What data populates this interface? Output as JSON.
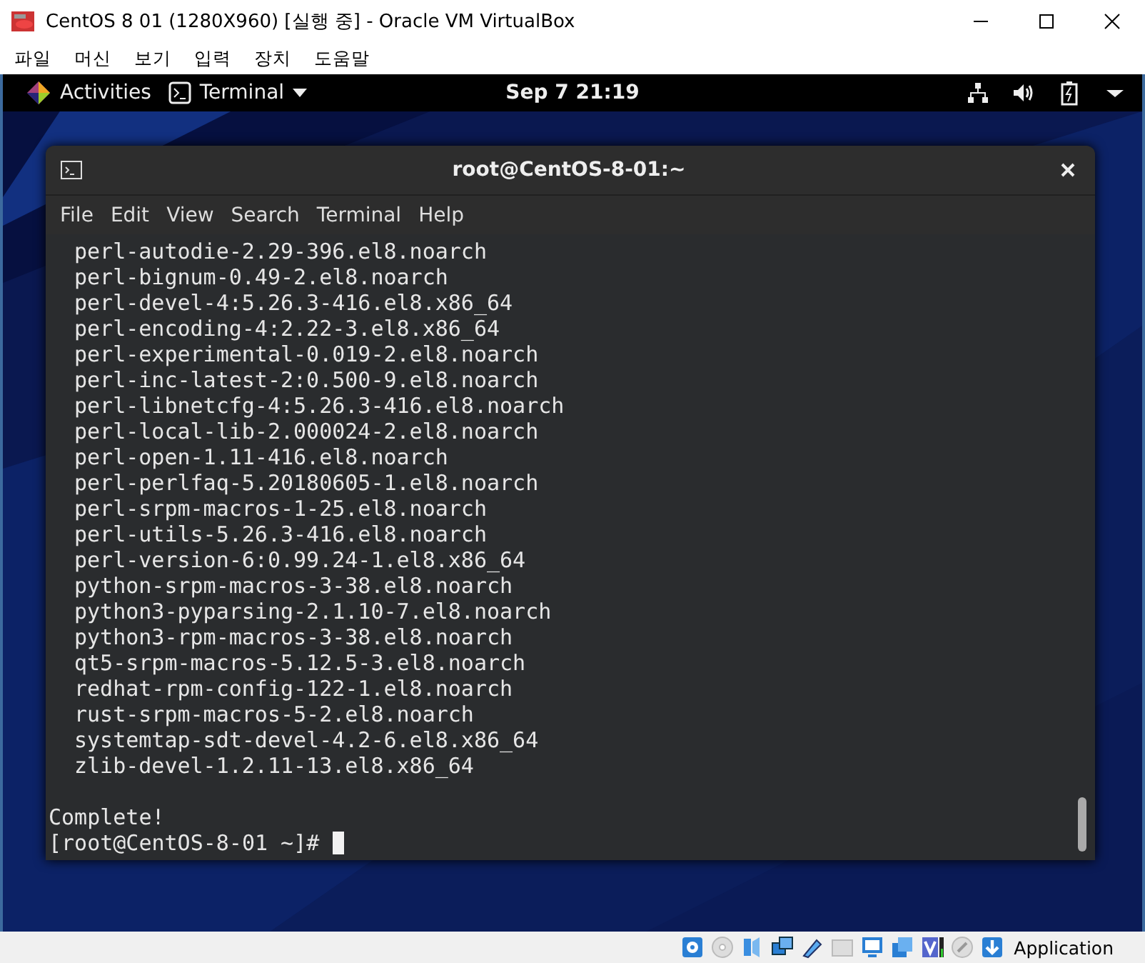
{
  "window": {
    "title": "CentOS 8 01 (1280X960) [실행 중] - Oracle VM VirtualBox"
  },
  "menu": [
    "파일",
    "머신",
    "보기",
    "입력",
    "장치",
    "도움말"
  ],
  "top_bar": {
    "activities": "Activities",
    "app": "Terminal",
    "clock": "Sep 7  21:19"
  },
  "terminal": {
    "title": "root@CentOS-8-01:~",
    "menu": [
      "File",
      "Edit",
      "View",
      "Search",
      "Terminal",
      "Help"
    ],
    "lines": [
      {
        "kind": "package",
        "text": "perl-autodie-2.29-396.el8.noarch"
      },
      {
        "kind": "package",
        "text": "perl-bignum-0.49-2.el8.noarch"
      },
      {
        "kind": "package",
        "text": "perl-devel-4:5.26.3-416.el8.x86_64"
      },
      {
        "kind": "package",
        "text": "perl-encoding-4:2.22-3.el8.x86_64"
      },
      {
        "kind": "package",
        "text": "perl-experimental-0.019-2.el8.noarch"
      },
      {
        "kind": "package",
        "text": "perl-inc-latest-2:0.500-9.el8.noarch"
      },
      {
        "kind": "package",
        "text": "perl-libnetcfg-4:5.26.3-416.el8.noarch"
      },
      {
        "kind": "package",
        "text": "perl-local-lib-2.000024-2.el8.noarch"
      },
      {
        "kind": "package",
        "text": "perl-open-1.11-416.el8.noarch"
      },
      {
        "kind": "package",
        "text": "perl-perlfaq-5.20180605-1.el8.noarch"
      },
      {
        "kind": "package",
        "text": "perl-srpm-macros-1-25.el8.noarch"
      },
      {
        "kind": "package",
        "text": "perl-utils-5.26.3-416.el8.noarch"
      },
      {
        "kind": "package",
        "text": "perl-version-6:0.99.24-1.el8.x86_64"
      },
      {
        "kind": "package",
        "text": "python-srpm-macros-3-38.el8.noarch"
      },
      {
        "kind": "package",
        "text": "python3-pyparsing-2.1.10-7.el8.noarch"
      },
      {
        "kind": "package",
        "text": "python3-rpm-macros-3-38.el8.noarch"
      },
      {
        "kind": "package",
        "text": "qt5-srpm-macros-5.12.5-3.el8.noarch"
      },
      {
        "kind": "package",
        "text": "redhat-rpm-config-122-1.el8.noarch"
      },
      {
        "kind": "package",
        "text": "rust-srpm-macros-5-2.el8.noarch"
      },
      {
        "kind": "package",
        "text": "systemtap-sdt-devel-4.2-6.el8.x86_64"
      },
      {
        "kind": "package",
        "text": "zlib-devel-1.2.11-13.el8.x86_64"
      },
      {
        "kind": "blank"
      },
      {
        "kind": "output",
        "text": "Complete!"
      },
      {
        "kind": "prompt",
        "text": "[root@CentOS-8-01 ~]#"
      }
    ]
  },
  "status_bar": {
    "label": "Application"
  }
}
